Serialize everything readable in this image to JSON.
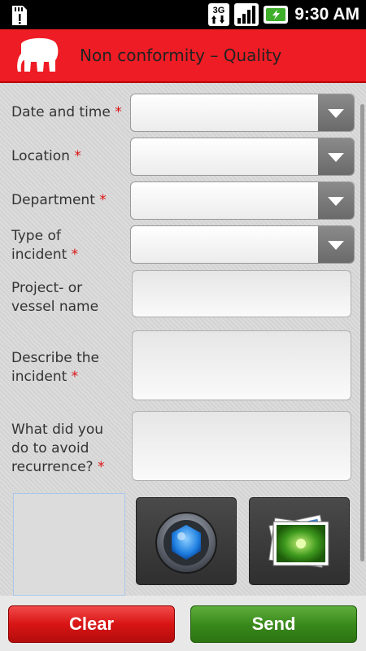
{
  "status_bar": {
    "network": "3G",
    "time": "9:30 AM"
  },
  "header": {
    "title": "Non conformity – Quality"
  },
  "form": {
    "date_time": {
      "label": "Date and time",
      "required": "*"
    },
    "location": {
      "label": "Location",
      "required": "*"
    },
    "department": {
      "label": "Department",
      "required": "*"
    },
    "incident_type": {
      "label_line1": "Type of",
      "label_line2": "incident",
      "required": "*"
    },
    "project_name": {
      "label_line1": "Project- or",
      "label_line2": "vessel name"
    },
    "describe": {
      "label_line1": "Describe the",
      "label_line2": "incident",
      "required": "*"
    },
    "avoid": {
      "label_line1": "What did you",
      "label_line2": "do to avoid",
      "label_line3": "recurrence?",
      "required": "*"
    }
  },
  "buttons": {
    "clear": "Clear",
    "send": "Send"
  },
  "colors": {
    "header_red": "#ee1c24",
    "clear_red": "#d91515",
    "send_green": "#3a8a1c",
    "required_red": "#d11"
  },
  "icons": {
    "camera": "camera-icon",
    "gallery": "gallery-icon",
    "logo": "elephant-logo"
  }
}
